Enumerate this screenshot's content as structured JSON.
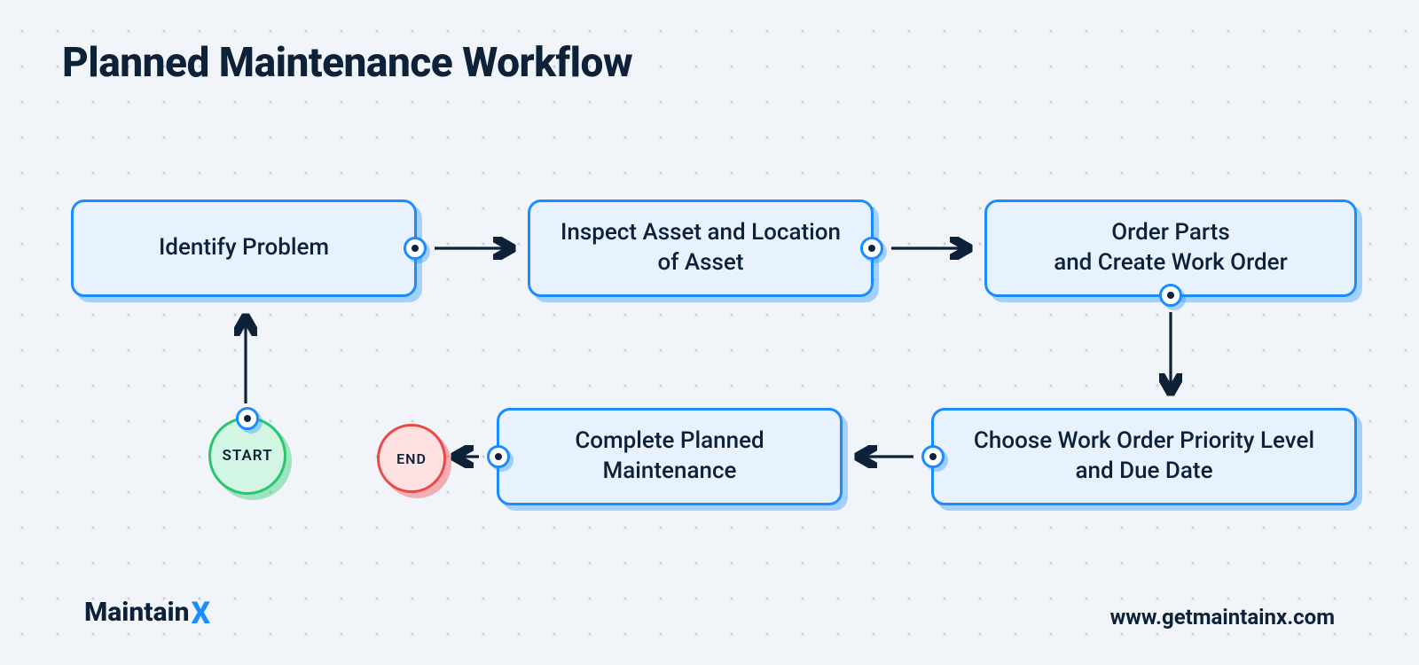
{
  "title": "Planned Maintenance Workflow",
  "start_label": "START",
  "end_label": "END",
  "nodes": {
    "identify": "Identify Problem",
    "inspect": "Inspect Asset and Location of Asset",
    "order": "Order Parts\nand Create Work Order",
    "choose": "Choose Work Order Priority Level and Due Date",
    "complete": "Complete Planned Maintenance"
  },
  "brand": {
    "name": "Maintain",
    "suffix": "X"
  },
  "url": "www.getmaintainx.com",
  "colors": {
    "node_border": "#1a8cff",
    "node_fill": "#e8f1fe",
    "start_border": "#27c76f",
    "start_fill": "#d3f5e3",
    "end_border": "#ef4747",
    "end_fill": "#ffe1e1",
    "ink": "#0d2138"
  }
}
